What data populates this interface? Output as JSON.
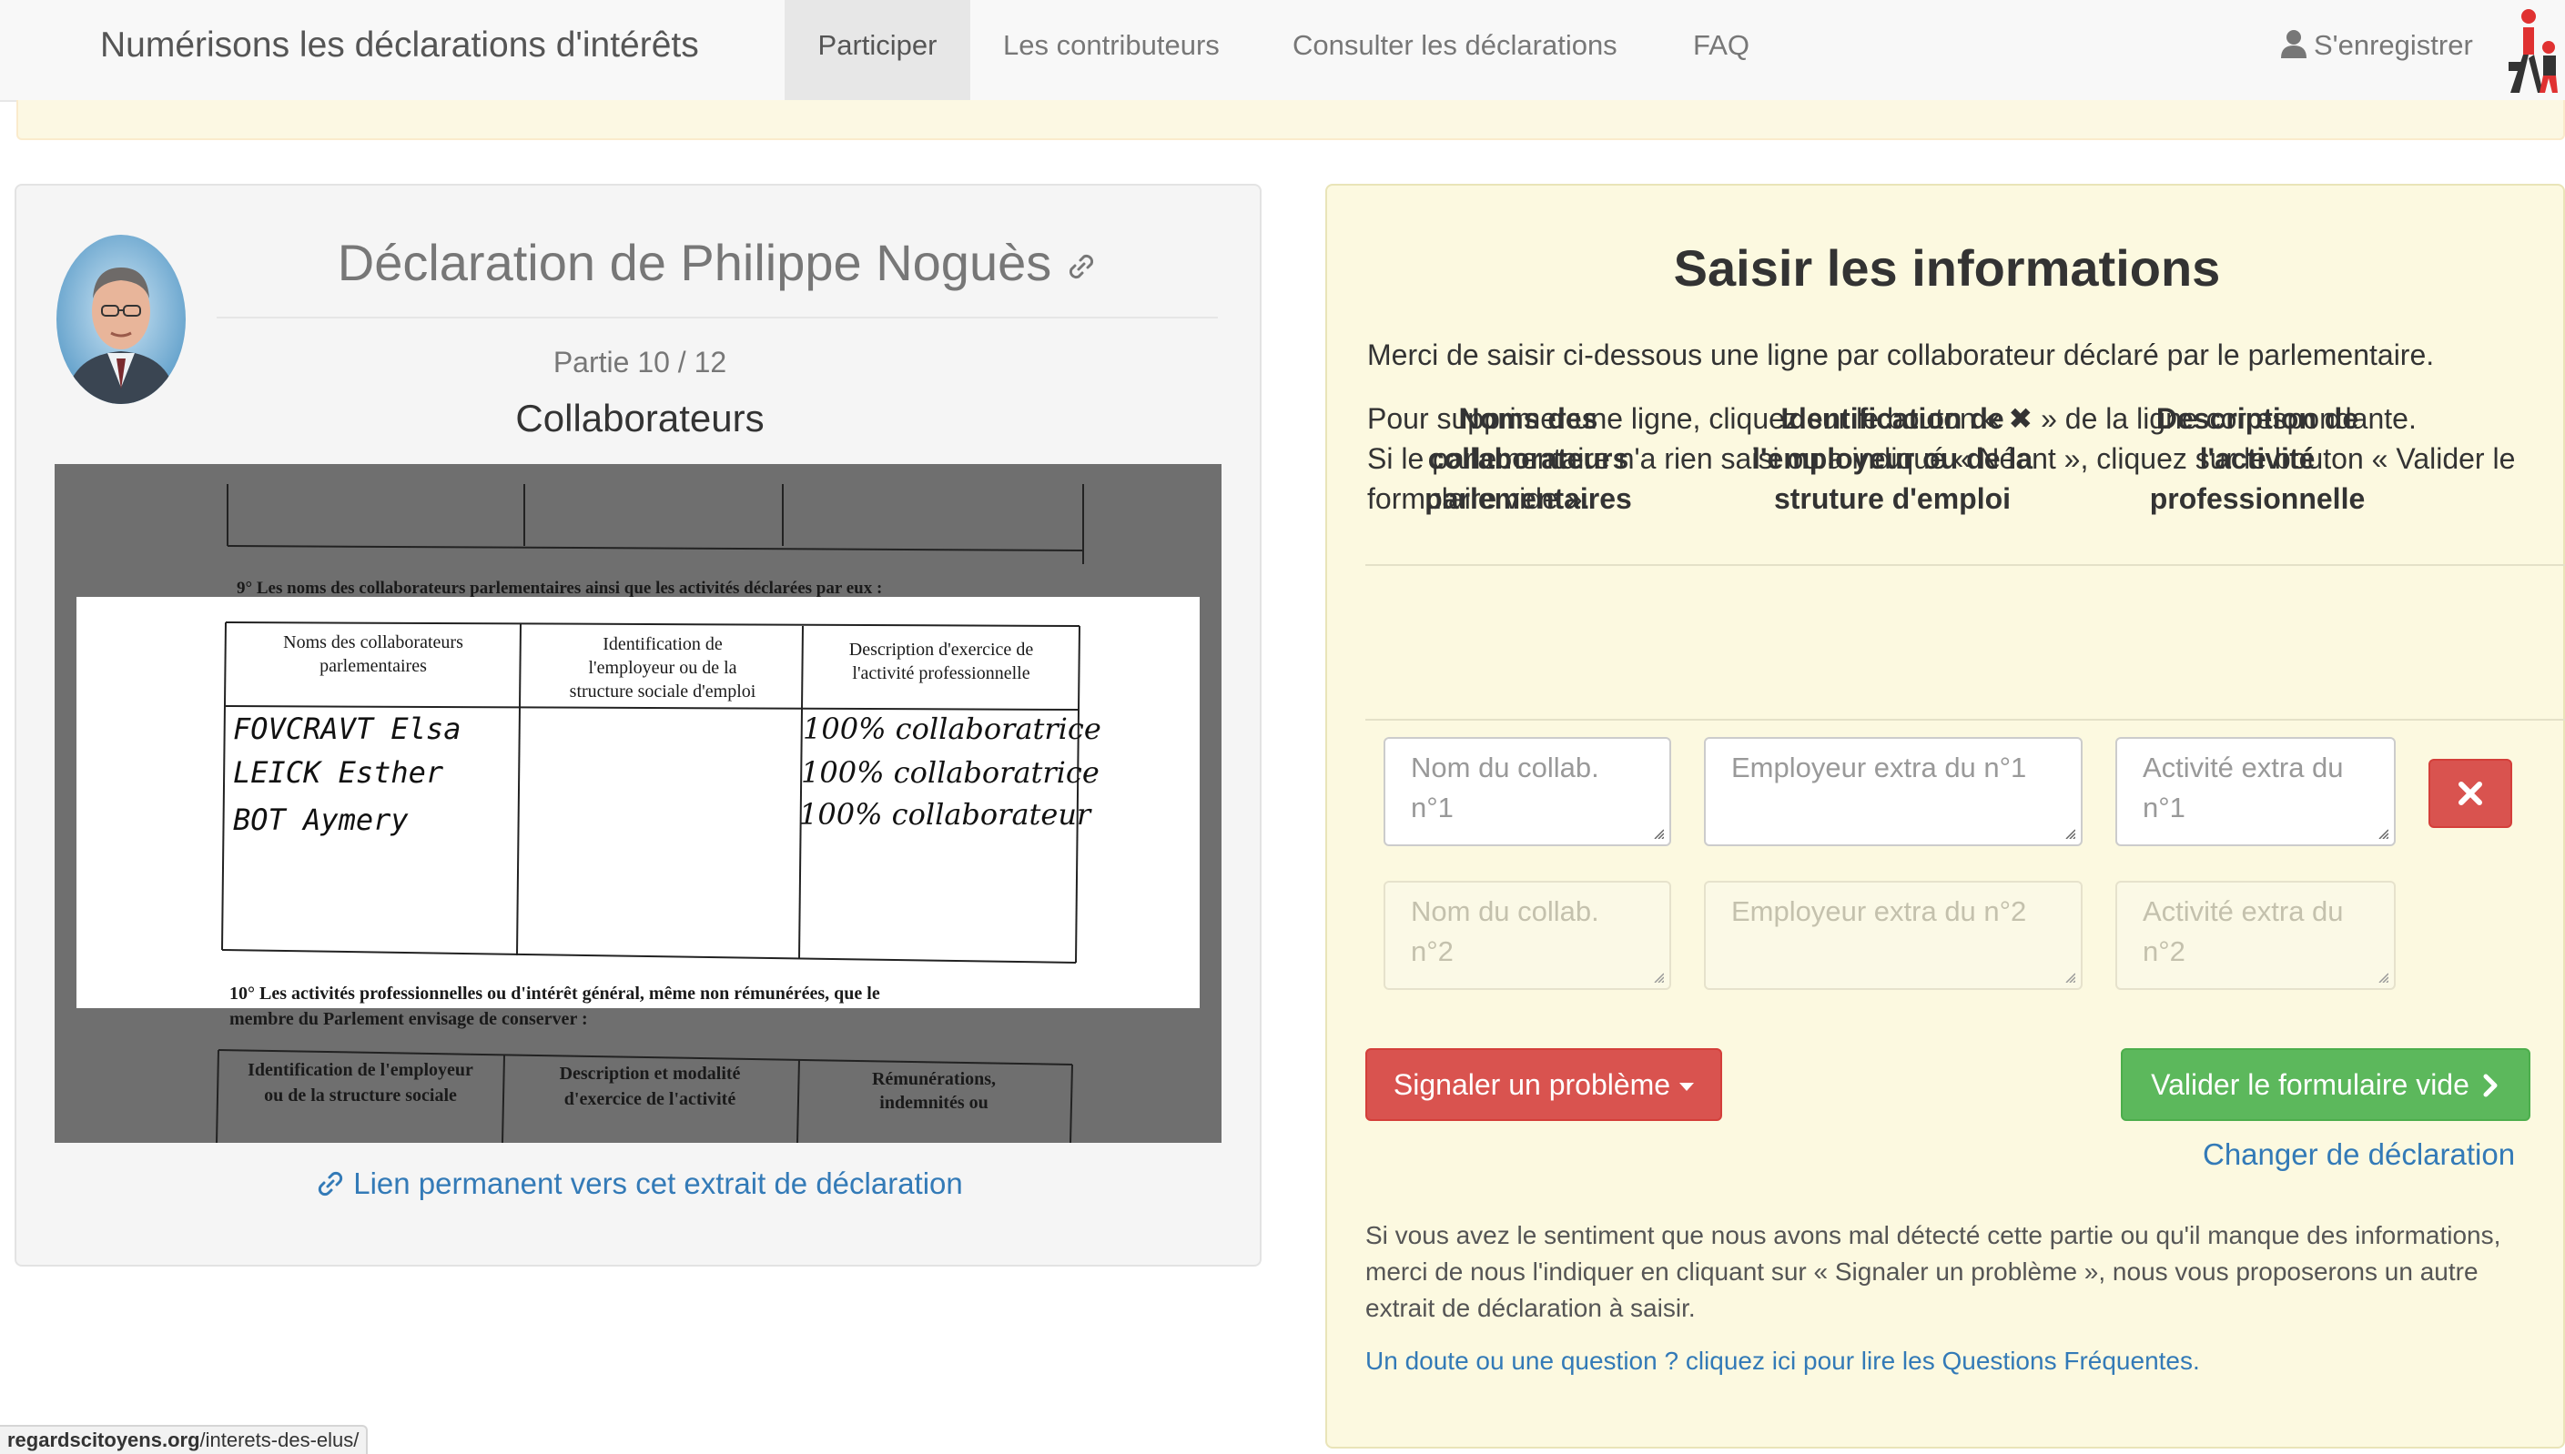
{
  "nav": {
    "brand": "Numérisons les déclarations d'intérêts",
    "items": [
      {
        "label": "Participer"
      },
      {
        "label": "Les contributeurs"
      },
      {
        "label": "Consulter les déclarations"
      },
      {
        "label": "FAQ"
      }
    ],
    "register": "S'enregistrer"
  },
  "left": {
    "title": "Déclaration de Philippe Noguès",
    "part": "Partie 10 / 12",
    "section": "Collaborateurs",
    "permalink": "Lien permanent vers cet extrait de déclaration",
    "scan": {
      "above_note": "9° Les noms des collaborateurs parlementaires ainsi que les activités déclarées par eux :",
      "col1": "Noms des collaborateurs parlementaires",
      "col2": "Identification de l'employeur ou de la structure sociale d'emploi",
      "col3": "Description d'exercice de l'activité professionnelle",
      "names": [
        "FOVCRAVT Elsa",
        "LEICK Esther",
        "BOT Aymery"
      ],
      "activities": [
        "100% collaboratrice",
        "100% collaboratrice",
        "100% collaborateur"
      ],
      "below_note_1": "10° Les activités professionnelles ou d'intérêt général, même non rémunérées, que le",
      "below_note_2": "membre du Parlement envisage de conserver :",
      "bottom_col1": "Identification de l'employeur ou de la structure sociale d'emploi",
      "bottom_col2": "Description et modalité d'exercice de l'activité",
      "bottom_col3": "Rémunérations, indemnités ou"
    }
  },
  "right": {
    "title": "Saisir les informations",
    "intro": "Merci de saisir ci-dessous une ligne par collaborateur déclaré par le parlementaire.",
    "delete_hint_pre": "Pour supprimer une ligne, cliquez sur le bouton « ",
    "delete_hint_post": " » de la ligne correspondante.",
    "empty_hint": "Si le parlementaire n'a rien saisi ou a indiqué « Néant », cliquez sur le bouton « Valider le formulaire vide ».",
    "headers": [
      "Noms des collaborateurs parlementaires",
      "Identification de l'employeur ou de la struture d'emploi",
      "Description de l'activité professionnelle"
    ],
    "rows": [
      {
        "name": "Nom du collab. n°1",
        "employer": "Employeur extra du n°1",
        "activity": "Activité extra du n°1"
      },
      {
        "name": "Nom du collab. n°2",
        "employer": "Employeur extra du n°2",
        "activity": "Activité extra du n°2"
      }
    ],
    "report_button": "Signaler un problème",
    "validate_button": "Valider le formulaire vide",
    "change_link": "Changer de déclaration",
    "help": "Si vous avez le sentiment que nous avons mal détecté cette partie ou qu'il manque des informations, merci de nous l'indiquer en cliquant sur « Signaler un problème », nous vous proposerons un autre extrait de déclaration à saisir.",
    "faq_link": "Un doute ou une question ? cliquez ici pour lire les Questions Fréquentes."
  },
  "status_bar": {
    "url_host": "regardscitoyens.org",
    "url_path": "/interets-des-elus/"
  },
  "colors": {
    "link": "#337ab7",
    "danger": "#d9534f",
    "success": "#5cb85c",
    "panel_yellow": "#fcf9e0",
    "navbar": "#f8f8f8"
  }
}
